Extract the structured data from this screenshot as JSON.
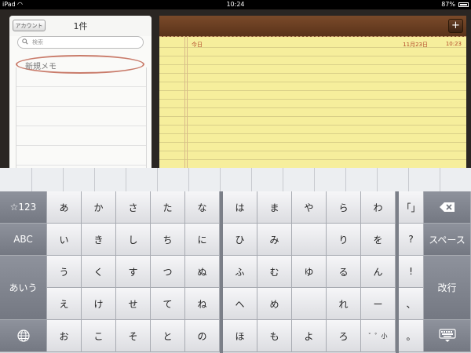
{
  "status_bar": {
    "device": "iPad",
    "time": "10:24",
    "battery": "87%"
  },
  "list_panel": {
    "account_button": "アカウント",
    "count_title": "1件",
    "search_placeholder": "検索",
    "items": [
      "新規メモ"
    ]
  },
  "note": {
    "today_label": "今日",
    "date": "11月23日",
    "time": "10:23",
    "add_button": "+"
  },
  "keyboard": {
    "left_column": [
      "☆123",
      "ABC",
      "あいう",
      "globe-icon"
    ],
    "kana_group_1": [
      [
        "あ",
        "か",
        "さ",
        "た",
        "な"
      ],
      [
        "い",
        "き",
        "し",
        "ち",
        "に"
      ],
      [
        "う",
        "く",
        "す",
        "つ",
        "ぬ"
      ],
      [
        "え",
        "け",
        "せ",
        "て",
        "ね"
      ],
      [
        "お",
        "こ",
        "そ",
        "と",
        "の"
      ]
    ],
    "kana_group_2": [
      [
        "は",
        "ま",
        "や",
        "ら",
        "わ"
      ],
      [
        "ひ",
        "み",
        "",
        "り",
        "を"
      ],
      [
        "ふ",
        "む",
        "ゆ",
        "る",
        "ん"
      ],
      [
        "へ",
        "め",
        "",
        "れ",
        "ー"
      ],
      [
        "ほ",
        "も",
        "よ",
        "ろ",
        "゛゜小"
      ]
    ],
    "punct_column": [
      "「」",
      "?",
      "!",
      "、",
      "。"
    ],
    "right_column": {
      "delete": "delete-icon",
      "space": "スペース",
      "return": "改行",
      "hide": "keyboard-hide-icon"
    }
  }
}
